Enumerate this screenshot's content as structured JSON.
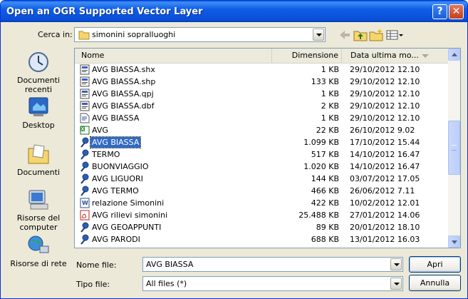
{
  "window": {
    "title": "Open an OGR Supported Vector Layer",
    "help": "?",
    "close": "✕"
  },
  "lookin": {
    "label": "Cerca in:",
    "value": "simonini sopralluoghi"
  },
  "places": [
    {
      "label": "Documenti recenti",
      "icon": "recent-documents-icon"
    },
    {
      "label": "Desktop",
      "icon": "desktop-icon"
    },
    {
      "label": "Documenti",
      "icon": "documents-folder-icon"
    },
    {
      "label": "Risorse del computer",
      "icon": "my-computer-icon"
    },
    {
      "label": "Risorse di rete",
      "icon": "network-icon"
    }
  ],
  "columns": {
    "name": "Nome",
    "size": "Dimensione",
    "date": "Data ultima mo..."
  },
  "files": [
    {
      "name": "AVG BIASSA.shx",
      "size": "1 KB",
      "date": "29/10/2012 12.10",
      "icon": "binary-file-icon"
    },
    {
      "name": "AVG BIASSA.shp",
      "size": "133 KB",
      "date": "29/10/2012 12.10",
      "icon": "binary-file-icon"
    },
    {
      "name": "AVG BIASSA.qpj",
      "size": "1 KB",
      "date": "29/10/2012 12.10",
      "icon": "binary-file-icon"
    },
    {
      "name": "AVG BIASSA.dbf",
      "size": "2 KB",
      "date": "29/10/2012 12.10",
      "icon": "binary-file-icon"
    },
    {
      "name": "AVG BIASSA",
      "size": "1 KB",
      "date": "29/10/2012 12.10",
      "icon": "text-file-icon"
    },
    {
      "name": "AVG",
      "size": "22 KB",
      "date": "26/10/2012 9.02",
      "icon": "excel-file-icon"
    },
    {
      "name": "AVG BIASSA",
      "size": "1.099 KB",
      "date": "17/10/2012 15.44",
      "icon": "kml-file-icon",
      "selected": true
    },
    {
      "name": "TERMO",
      "size": "517 KB",
      "date": "14/10/2012 16.47",
      "icon": "kml-file-icon"
    },
    {
      "name": "BUONVIAGGIO",
      "size": "1.020 KB",
      "date": "14/10/2012 16.47",
      "icon": "kml-file-icon"
    },
    {
      "name": "AVG LIGUORI",
      "size": "144 KB",
      "date": "03/07/2012 17.05",
      "icon": "kml-file-icon"
    },
    {
      "name": "AVG TERMO",
      "size": "466 KB",
      "date": "26/06/2012 7.11",
      "icon": "kml-file-icon"
    },
    {
      "name": "relazione Simonini",
      "size": "422 KB",
      "date": "10/02/2012 12.01",
      "icon": "word-file-icon"
    },
    {
      "name": "AVG rilievi simonini",
      "size": "25.488 KB",
      "date": "27/01/2012 14.06",
      "icon": "pdf-file-icon"
    },
    {
      "name": "AVG GEOAPPUNTI",
      "size": "89 KB",
      "date": "20/01/2012 18.10",
      "icon": "kml-file-icon"
    },
    {
      "name": "AVG PARODI",
      "size": "688 KB",
      "date": "13/01/2012 16.03",
      "icon": "kml-file-icon"
    }
  ],
  "filename": {
    "label": "Nome file:",
    "value": "AVG BIASSA"
  },
  "filetype": {
    "label": "Tipo file:",
    "value": "All files (*)"
  },
  "buttons": {
    "open": "Apri",
    "cancel": "Annulla"
  }
}
